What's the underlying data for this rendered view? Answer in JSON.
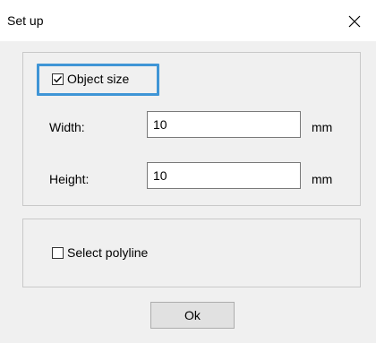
{
  "dialog": {
    "title": "Set up",
    "close_icon": "close-icon"
  },
  "object_size": {
    "label": "Object size",
    "checked": true,
    "width_label": "Width:",
    "width_value": "10",
    "width_unit": "mm",
    "height_label": "Height:",
    "height_value": "10",
    "height_unit": "mm"
  },
  "polyline": {
    "label": "Select polyline",
    "checked": false
  },
  "buttons": {
    "ok_label": "Ok"
  },
  "colors": {
    "focus_highlight": "#3f95d6",
    "client_background": "#f0f0f0"
  }
}
